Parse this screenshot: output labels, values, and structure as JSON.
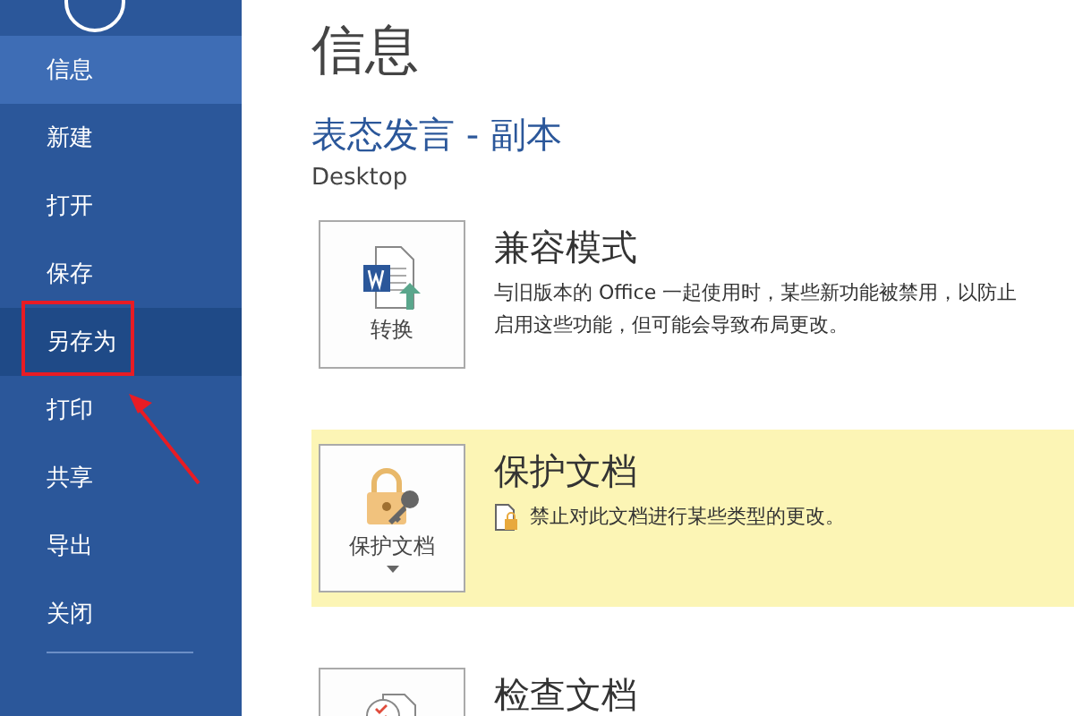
{
  "sidebar": {
    "items": [
      {
        "label": "信息",
        "selected": true,
        "hovered": false
      },
      {
        "label": "新建",
        "selected": false,
        "hovered": false
      },
      {
        "label": "打开",
        "selected": false,
        "hovered": false
      },
      {
        "label": "保存",
        "selected": false,
        "hovered": false
      },
      {
        "label": "另存为",
        "selected": false,
        "hovered": true
      },
      {
        "label": "打印",
        "selected": false,
        "hovered": false
      },
      {
        "label": "共享",
        "selected": false,
        "hovered": false
      },
      {
        "label": "导出",
        "selected": false,
        "hovered": false
      },
      {
        "label": "关闭",
        "selected": false,
        "hovered": false
      }
    ]
  },
  "page": {
    "title": "信息",
    "document_title": "表态发言 - 副本",
    "location": "Desktop"
  },
  "sections": [
    {
      "kind": "convert",
      "button_label": "转换",
      "dropdown": false,
      "title": "兼容模式",
      "highlighted": false,
      "description": [
        "与旧版本的 Office 一起使用时，某些新功能被禁用，以防止",
        "启用这些功能，但可能会导致布局更改。"
      ],
      "note_icon": false
    },
    {
      "kind": "protect",
      "button_label": "保护文档",
      "dropdown": true,
      "title": "保护文档",
      "highlighted": true,
      "description": [
        "禁止对此文档进行某些类型的更改。"
      ],
      "note_icon": true
    },
    {
      "kind": "inspect",
      "title": "检查文档",
      "highlighted": false
    }
  ]
}
